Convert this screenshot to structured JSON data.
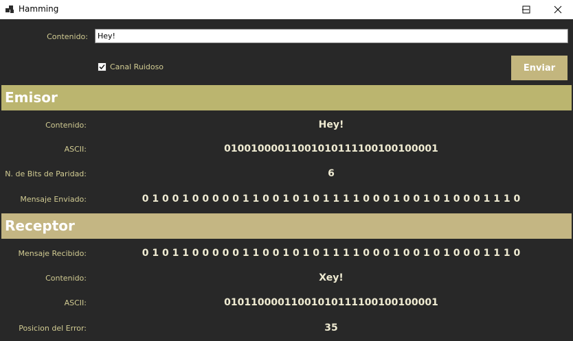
{
  "window": {
    "title": "Hamming"
  },
  "form": {
    "content_label": "Contenido:",
    "content_value": "Hey!",
    "noisy_label": "Canal Ruidoso",
    "noisy_checked": true,
    "send_label": "Enviar"
  },
  "colors": {
    "emisor_band": "#bbb56f",
    "receptor_band": "#c4b683",
    "label": "#d2cc93",
    "value": "#efebd2",
    "background": "#282828"
  },
  "emisor": {
    "title": "Emisor",
    "content_label": "Contenido:",
    "content_value": "Hey!",
    "ascii_label": "ASCII:",
    "ascii_value": "01001000011001010111100100100001",
    "parity_label": "N. de Bits de Paridad:",
    "parity_value": "6",
    "sent_label": "Mensaje Enviado:",
    "sent_value": "0 1 0 0 1 0 0 0 0 0 1 1 0 0 1 0 1 0 1 1 1 1 0 0 0 1 0 0 1 0 1 0 0 0 1 1 1 0"
  },
  "receptor": {
    "title": "Receptor",
    "received_label": "Mensaje Recibido:",
    "received_value": "0 1 0 1 1 0 0 0 0 0 1 1 0 0 1 0 1 0 1 1 1 1 0 0 0 1 0 0 1 0 1 0 0 0 1 1 1 0",
    "content_label": "Contenido:",
    "content_value": "Xey!",
    "ascii_label": "ASCII:",
    "ascii_value": "01011000011001010111100100100001",
    "error_label": "Posicion del Error:",
    "error_value": "35"
  }
}
